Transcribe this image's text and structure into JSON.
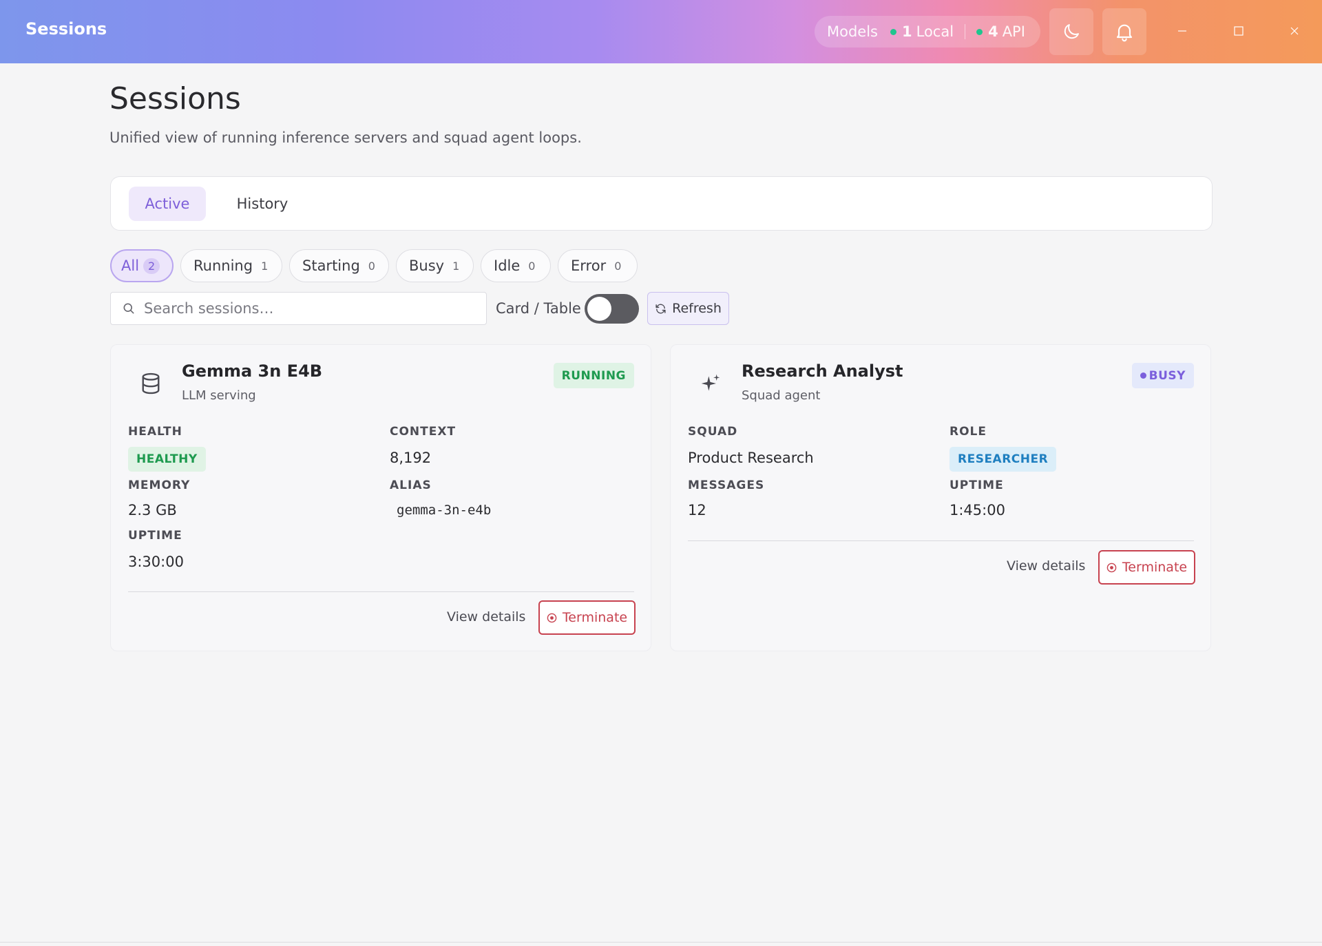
{
  "app": {
    "title": "Sessions"
  },
  "titlebar": {
    "models_label": "Models",
    "local_count": "1",
    "local_label": "Local",
    "api_count": "4",
    "api_label": "API",
    "status_dot_color": "#1fc58e",
    "icons": [
      "moon-icon",
      "bell-icon",
      "minimize-icon",
      "maximize-icon",
      "close-icon"
    ]
  },
  "header": {
    "title": "Sessions",
    "subtitle": "Unified view of running inference servers and squad agent loops."
  },
  "tabs": [
    {
      "label": "Active",
      "active": true
    },
    {
      "label": "History",
      "active": false
    }
  ],
  "filters": [
    {
      "label": "All",
      "count": "2",
      "active": true
    },
    {
      "label": "Running",
      "count": "1",
      "active": false
    },
    {
      "label": "Starting",
      "count": "0",
      "active": false
    },
    {
      "label": "Busy",
      "count": "1",
      "active": false
    },
    {
      "label": "Idle",
      "count": "0",
      "active": false
    },
    {
      "label": "Error",
      "count": "0",
      "active": false
    }
  ],
  "toolbar": {
    "search_placeholder": "Search sessions…",
    "view_toggle_label": "Card / Table",
    "view_toggle_on": false,
    "refresh_label": "Refresh"
  },
  "cards": [
    {
      "title": "Gemma 3n E4B",
      "subtitle": "LLM serving",
      "status": "RUNNING",
      "icon": "database-icon",
      "fields": {
        "health_label": "HEALTH",
        "health_value": "HEALTHY",
        "context_label": "CONTEXT",
        "context_value": "8,192",
        "memory_label": "MEMORY",
        "memory_value": "2.3 GB",
        "alias_label": "ALIAS",
        "alias_value": "gemma-3n-e4b",
        "uptime_label": "UPTIME",
        "uptime_value": "3:30:00"
      },
      "view_details": "View details",
      "terminate": "Terminate"
    },
    {
      "title": "Research Analyst",
      "subtitle": "Squad agent",
      "status": "BUSY",
      "icon": "sparkle-icon",
      "fields": {
        "squad_label": "SQUAD",
        "squad_value": "Product Research",
        "role_label": "ROLE",
        "role_value": "RESEARCHER",
        "messages_label": "MESSAGES",
        "messages_value": "12",
        "uptime_label": "UPTIME",
        "uptime_value": "1:45:00"
      },
      "view_details": "View details",
      "terminate": "Terminate"
    }
  ]
}
